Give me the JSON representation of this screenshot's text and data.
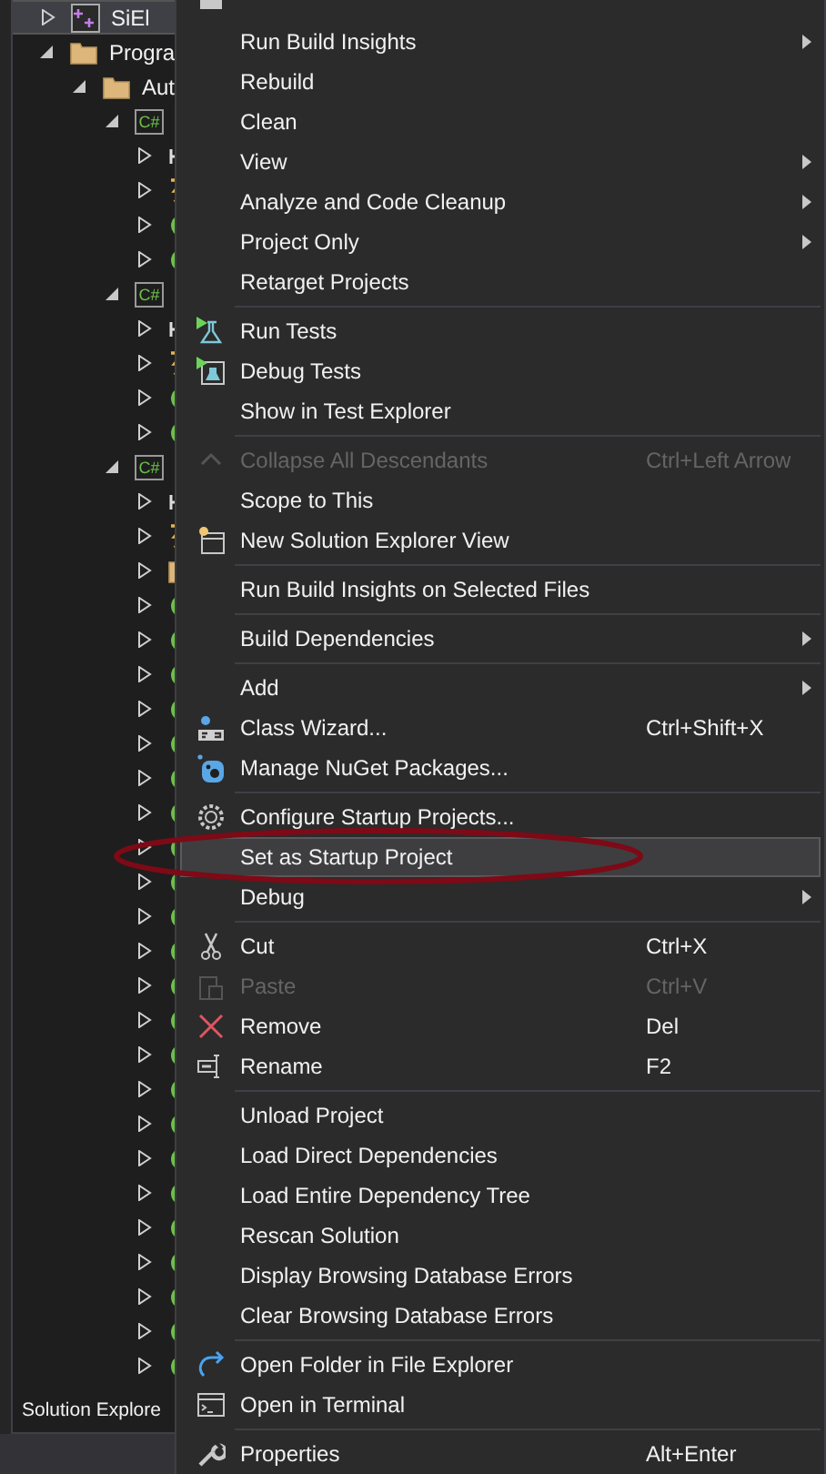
{
  "tree": {
    "items": [
      {
        "label": "SiEl",
        "kind": "solution-project",
        "expanded": false,
        "selected": true
      },
      {
        "label": "Progra",
        "kind": "folder",
        "expanded": true,
        "selected": false,
        "children": [
          {
            "label": "Aut",
            "kind": "folder",
            "expanded": true,
            "selected": false,
            "children": [
              {
                "kind": "csproj",
                "badge": "C#",
                "expanded": true,
                "selected": false,
                "children": [
                  {
                    "kind": "dependencies",
                    "expanded": false,
                    "selected": false
                  },
                  {
                    "kind": "properties",
                    "expanded": false,
                    "selected": false
                  },
                  {
                    "kind": "class",
                    "expanded": false,
                    "selected": false
                  },
                  {
                    "kind": "class",
                    "expanded": false,
                    "selected": false
                  }
                ]
              },
              {
                "kind": "csproj",
                "badge": "C#",
                "expanded": true,
                "selected": false,
                "children": [
                  {
                    "kind": "dependencies",
                    "expanded": false,
                    "selected": false
                  },
                  {
                    "kind": "properties",
                    "expanded": false,
                    "selected": false
                  },
                  {
                    "kind": "class",
                    "expanded": false,
                    "selected": false
                  },
                  {
                    "kind": "class",
                    "expanded": false,
                    "selected": false
                  }
                ]
              },
              {
                "kind": "csproj",
                "badge": "C#",
                "expanded": true,
                "selected": false,
                "children": [
                  {
                    "kind": "dependencies",
                    "expanded": false,
                    "selected": false
                  },
                  {
                    "kind": "properties",
                    "expanded": false,
                    "selected": false
                  },
                  {
                    "kind": "folder",
                    "expanded": false,
                    "selected": false
                  },
                  {
                    "kind": "class",
                    "expanded": false,
                    "selected": false
                  },
                  {
                    "kind": "class",
                    "expanded": false,
                    "selected": false
                  },
                  {
                    "kind": "class",
                    "expanded": false,
                    "selected": false
                  },
                  {
                    "kind": "class",
                    "expanded": false,
                    "selected": false
                  },
                  {
                    "kind": "class",
                    "expanded": false,
                    "selected": false
                  },
                  {
                    "kind": "class",
                    "expanded": false,
                    "selected": false
                  },
                  {
                    "kind": "class",
                    "expanded": false,
                    "selected": false
                  },
                  {
                    "kind": "class",
                    "expanded": false,
                    "selected": false
                  },
                  {
                    "kind": "class",
                    "expanded": false,
                    "selected": false
                  },
                  {
                    "kind": "class",
                    "expanded": false,
                    "selected": false
                  },
                  {
                    "kind": "class",
                    "expanded": false,
                    "selected": false
                  },
                  {
                    "kind": "class",
                    "expanded": false,
                    "selected": false
                  },
                  {
                    "kind": "class",
                    "expanded": false,
                    "selected": false
                  },
                  {
                    "kind": "class",
                    "expanded": false,
                    "selected": false
                  },
                  {
                    "kind": "class",
                    "expanded": false,
                    "selected": false
                  },
                  {
                    "kind": "class",
                    "expanded": false,
                    "selected": false
                  },
                  {
                    "kind": "class",
                    "expanded": false,
                    "selected": false
                  },
                  {
                    "kind": "class",
                    "expanded": false,
                    "selected": false
                  },
                  {
                    "kind": "class",
                    "expanded": false,
                    "selected": false
                  },
                  {
                    "kind": "class",
                    "expanded": false,
                    "selected": false
                  },
                  {
                    "kind": "class",
                    "expanded": false,
                    "selected": false
                  },
                  {
                    "kind": "class",
                    "expanded": false,
                    "selected": false
                  },
                  {
                    "kind": "class",
                    "expanded": false,
                    "selected": false
                  }
                ]
              }
            ]
          }
        ]
      }
    ]
  },
  "panel_tab": "Solution Explore",
  "menu": {
    "groups": [
      [
        {
          "kind": "build",
          "selected": false
        },
        {
          "label": "Run Build Insights",
          "submenu": true,
          "disabled": false,
          "selected": false
        },
        {
          "label": "Rebuild",
          "submenu": false,
          "disabled": false,
          "selected": false
        },
        {
          "label": "Clean",
          "submenu": false,
          "disabled": false,
          "selected": false
        },
        {
          "label": "View",
          "submenu": true,
          "disabled": false,
          "selected": false
        },
        {
          "label": "Analyze and Code Cleanup",
          "submenu": true,
          "disabled": false,
          "selected": false
        },
        {
          "label": "Project Only",
          "submenu": true,
          "disabled": false,
          "selected": false
        },
        {
          "label": "Retarget Projects",
          "submenu": false,
          "disabled": false,
          "selected": false
        }
      ],
      [
        {
          "label": "Run Tests",
          "kind": "run-tests",
          "submenu": false,
          "disabled": false,
          "selected": false
        },
        {
          "label": "Debug Tests",
          "kind": "debug-tests",
          "submenu": false,
          "disabled": false,
          "selected": false
        },
        {
          "label": "Show in Test Explorer",
          "submenu": false,
          "disabled": false,
          "selected": false
        }
      ],
      [
        {
          "label": "Collapse All Descendants",
          "kind": "collapse",
          "shortcut": "Ctrl+Left Arrow",
          "submenu": false,
          "disabled": true,
          "selected": false
        },
        {
          "label": "Scope to This",
          "submenu": false,
          "disabled": false,
          "selected": false
        },
        {
          "label": "New Solution Explorer View",
          "kind": "new-view",
          "submenu": false,
          "disabled": false,
          "selected": false
        }
      ],
      [
        {
          "label": "Run Build Insights on Selected Files",
          "submenu": false,
          "disabled": false,
          "selected": false
        }
      ],
      [
        {
          "label": "Build Dependencies",
          "submenu": true,
          "disabled": false,
          "selected": false
        }
      ],
      [
        {
          "label": "Add",
          "submenu": true,
          "disabled": false,
          "selected": false
        },
        {
          "label": "Class Wizard...",
          "kind": "class-wizard",
          "shortcut": "Ctrl+Shift+X",
          "submenu": false,
          "disabled": false,
          "selected": false
        },
        {
          "label": "Manage NuGet Packages...",
          "kind": "nuget",
          "submenu": false,
          "disabled": false,
          "selected": false
        }
      ],
      [
        {
          "label": "Configure Startup Projects...",
          "kind": "gear",
          "submenu": false,
          "disabled": false,
          "selected": false
        },
        {
          "label": "Set as Startup Project",
          "submenu": false,
          "disabled": false,
          "selected": true
        },
        {
          "label": "Debug",
          "submenu": true,
          "disabled": false,
          "selected": false
        }
      ],
      [
        {
          "label": "Cut",
          "kind": "cut",
          "shortcut": "Ctrl+X",
          "submenu": false,
          "disabled": false,
          "selected": false
        },
        {
          "label": "Paste",
          "kind": "paste",
          "shortcut": "Ctrl+V",
          "submenu": false,
          "disabled": true,
          "selected": false
        },
        {
          "label": "Remove",
          "kind": "remove",
          "shortcut": "Del",
          "submenu": false,
          "disabled": false,
          "selected": false
        },
        {
          "label": "Rename",
          "kind": "rename",
          "shortcut": "F2",
          "submenu": false,
          "disabled": false,
          "selected": false
        }
      ],
      [
        {
          "label": "Unload Project",
          "submenu": false,
          "disabled": false,
          "selected": false
        },
        {
          "label": "Load Direct Dependencies",
          "submenu": false,
          "disabled": false,
          "selected": false
        },
        {
          "label": "Load Entire Dependency Tree",
          "submenu": false,
          "disabled": false,
          "selected": false
        },
        {
          "label": "Rescan Solution",
          "submenu": false,
          "disabled": false,
          "selected": false
        },
        {
          "label": "Display Browsing Database Errors",
          "submenu": false,
          "disabled": false,
          "selected": false
        },
        {
          "label": "Clear Browsing Database Errors",
          "submenu": false,
          "disabled": false,
          "selected": false
        }
      ],
      [
        {
          "label": "Open Folder in File Explorer",
          "kind": "open-folder",
          "submenu": false,
          "disabled": false,
          "selected": false
        },
        {
          "label": "Open in Terminal",
          "kind": "terminal",
          "submenu": false,
          "disabled": false,
          "selected": false
        }
      ],
      [
        {
          "label": "Properties",
          "kind": "wrench",
          "shortcut": "Alt+Enter",
          "submenu": false,
          "disabled": false,
          "selected": false
        }
      ]
    ]
  },
  "annotation": {
    "kind": "ellipse"
  }
}
